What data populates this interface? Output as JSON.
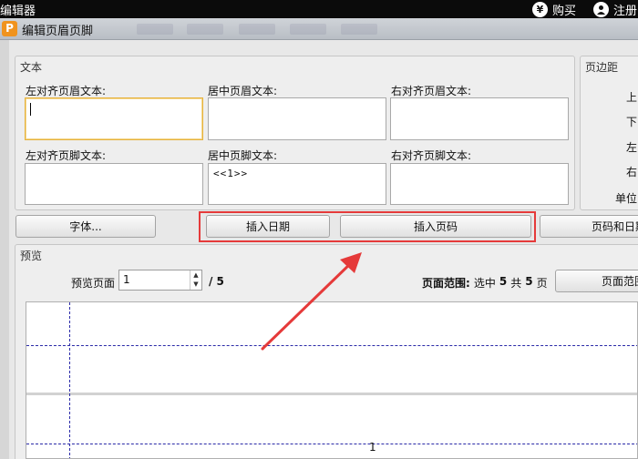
{
  "topbar": {
    "app_name": "编辑器",
    "buy_icon": "¥",
    "buy_label": "购买",
    "user_icon": "user",
    "register_label": "注册"
  },
  "dialog": {
    "title": "编辑页眉页脚",
    "icon_letter": "P",
    "text_group": {
      "title": "文本",
      "header_left_label": "左对齐页眉文本:",
      "header_center_label": "居中页眉文本:",
      "header_right_label": "右对齐页眉文本:",
      "footer_left_label": "左对齐页脚文本:",
      "footer_center_label": "居中页脚文本:",
      "footer_right_label": "右对齐页脚文本:",
      "header_left_value": "",
      "header_center_value": "",
      "header_right_value": "",
      "footer_left_value": "",
      "footer_center_value": "<<1>>",
      "footer_right_value": ""
    },
    "margin_group": {
      "title": "页边距",
      "top": "上",
      "bottom": "下",
      "left": "左",
      "right": "右",
      "unit": "单位:"
    },
    "buttons": {
      "font": "字体...",
      "insert_date": "插入日期",
      "insert_page_number": "插入页码",
      "page_and_date": "页码和日期"
    },
    "preview": {
      "title": "预览",
      "preview_page_label": "预览页面",
      "page_value": "1",
      "page_total": "/ 5",
      "range_label": "页面范围:",
      "range_selected_word": "选中",
      "range_selected": "5",
      "range_total_word": "共",
      "range_total": "5",
      "range_unit": "页",
      "range_button": "页面范围",
      "footer_page_number": "1"
    }
  }
}
